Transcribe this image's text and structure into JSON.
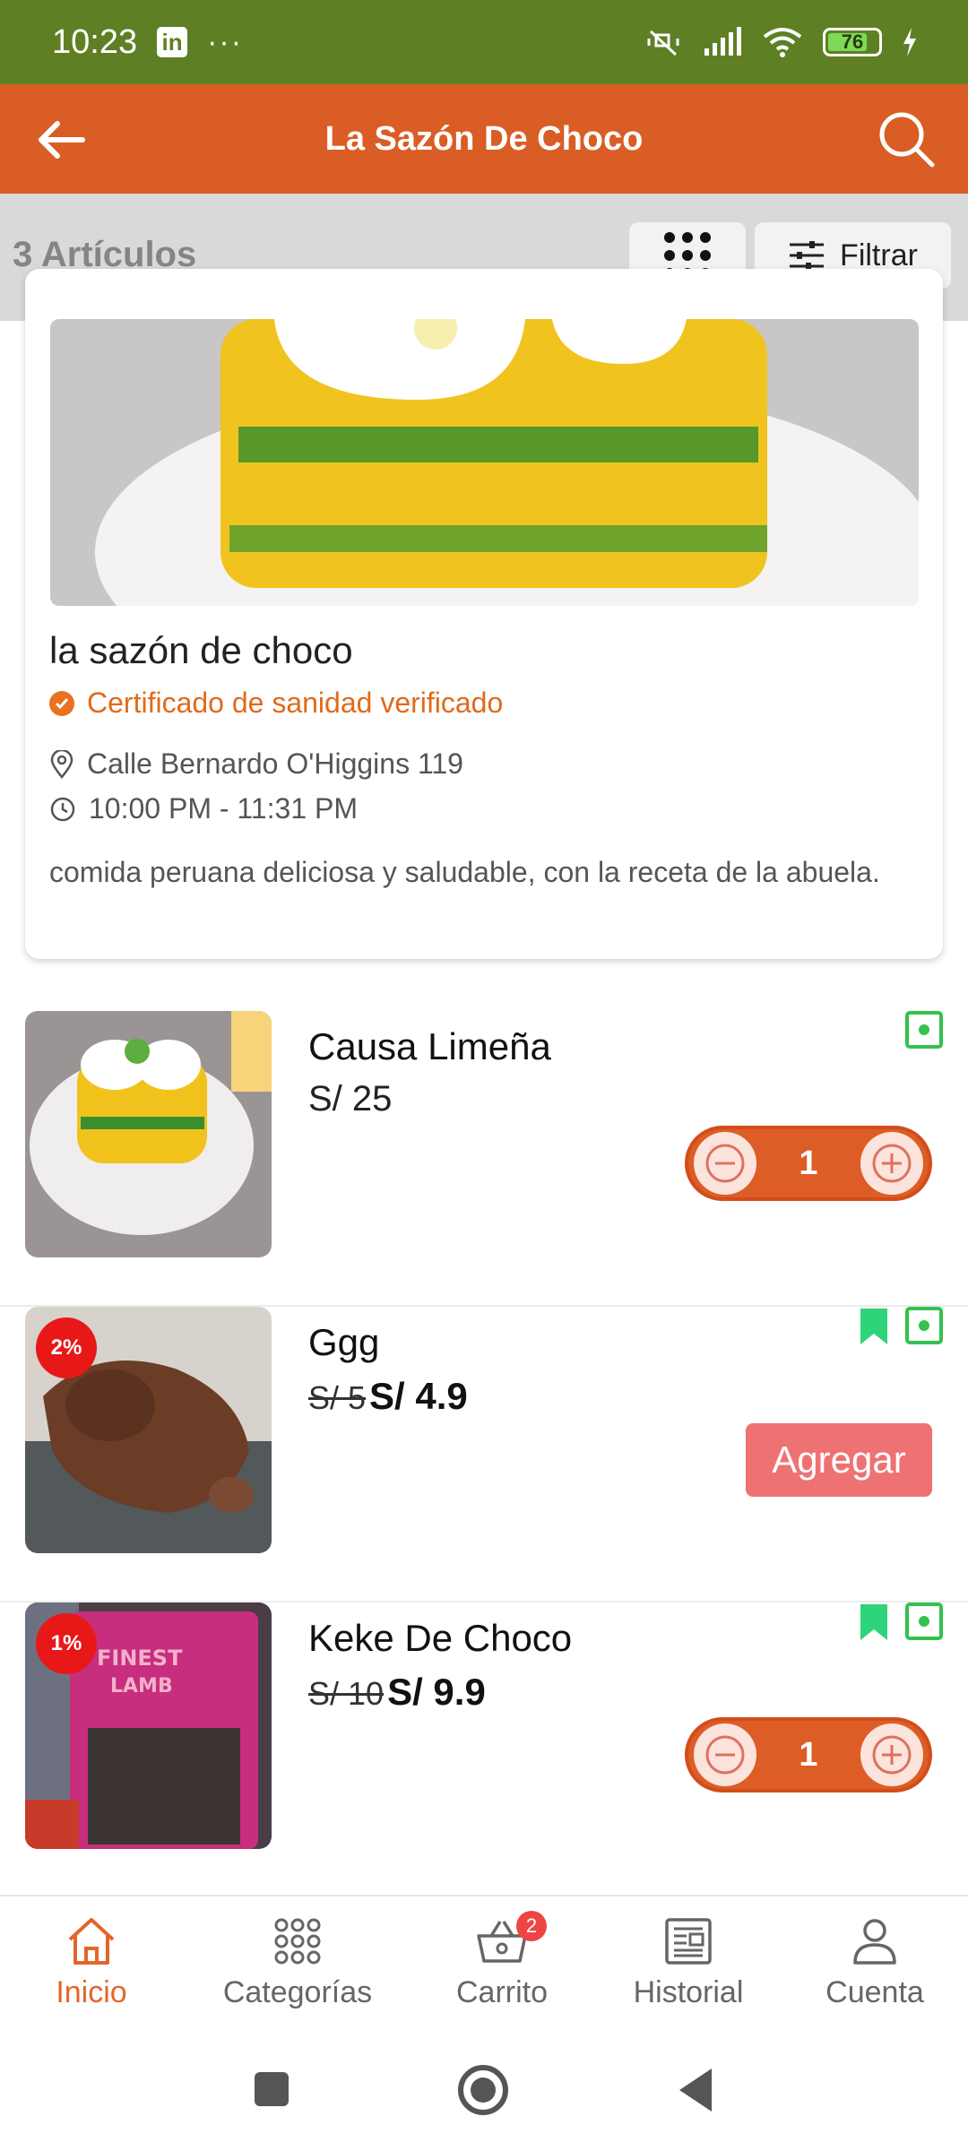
{
  "status_bar": {
    "time": "10:23",
    "linkedin": "in",
    "dots": "···",
    "battery": "76"
  },
  "header": {
    "title": "La Sazón De Choco"
  },
  "toolbar": {
    "count": "3 Artículos",
    "filter_label": "Filtrar"
  },
  "store": {
    "name": "la sazón de choco",
    "verified": "Certificado de sanidad verificado",
    "address": "Calle Bernardo O'Higgins 119",
    "hours": "10:00 PM - 11:31 PM",
    "description": "comida peruana deliciosa y saludable, con la receta de la abuela."
  },
  "products": [
    {
      "name": "Causa Limeña",
      "price": "S/ 25",
      "qty": "1"
    },
    {
      "name": "Ggg",
      "old_price": "S/ 5",
      "price": "S/ 4.9",
      "discount": "2%",
      "add_label": "Agregar"
    },
    {
      "name": "Keke De Choco",
      "old_price": "S/ 10",
      "price": "S/ 9.9",
      "discount": "1%",
      "qty": "1"
    }
  ],
  "nav": {
    "items": [
      {
        "label": "Inicio"
      },
      {
        "label": "Categorías"
      },
      {
        "label": "Carrito",
        "badge": "2"
      },
      {
        "label": "Historial"
      },
      {
        "label": "Cuenta"
      }
    ]
  },
  "colors": {
    "status_bar": "#5f7f24",
    "app_bar": "#d95d24",
    "accent": "#e2662a",
    "veg": "#33c24d",
    "discount": "#e81818"
  }
}
